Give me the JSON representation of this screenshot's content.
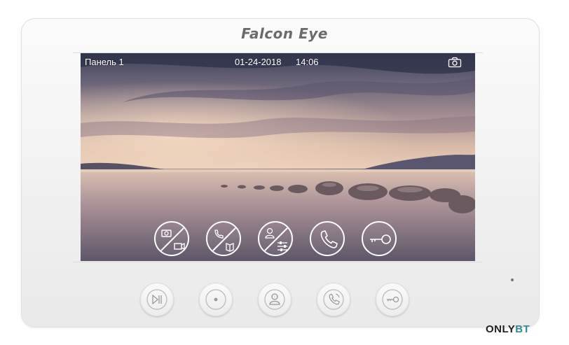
{
  "brand": {
    "logo_text": "Falcon Eye"
  },
  "screen": {
    "panel_label": "Панель 1",
    "date": "01-24-2018",
    "time": "14:06",
    "snapshot_icon": "camera-icon"
  },
  "screen_buttons": [
    {
      "name": "photo-video-disabled-button",
      "icon": "camera-video-crossed-icon"
    },
    {
      "name": "call-log-disabled-button",
      "icon": "call-book-crossed-icon"
    },
    {
      "name": "user-settings-disabled-button",
      "icon": "user-sliders-crossed-icon"
    },
    {
      "name": "answer-call-button",
      "icon": "phone-icon"
    },
    {
      "name": "unlock-door-button",
      "icon": "key-icon"
    }
  ],
  "hardware_buttons": [
    {
      "name": "play-pause-button",
      "icon": "play-pause-icon"
    },
    {
      "name": "monitor-button",
      "icon": "record-icon"
    },
    {
      "name": "contacts-button",
      "icon": "user-icon"
    },
    {
      "name": "talk-button",
      "icon": "phone-icon"
    },
    {
      "name": "unlock-button",
      "icon": "key-icon"
    }
  ],
  "watermark": {
    "prefix": "ONLY",
    "suffix": "BT"
  },
  "colors": {
    "device": "#f4f4f4",
    "overlay": "#ffffff",
    "logo": "#6b6b6b",
    "watermark_accent": "#2e8a96"
  }
}
